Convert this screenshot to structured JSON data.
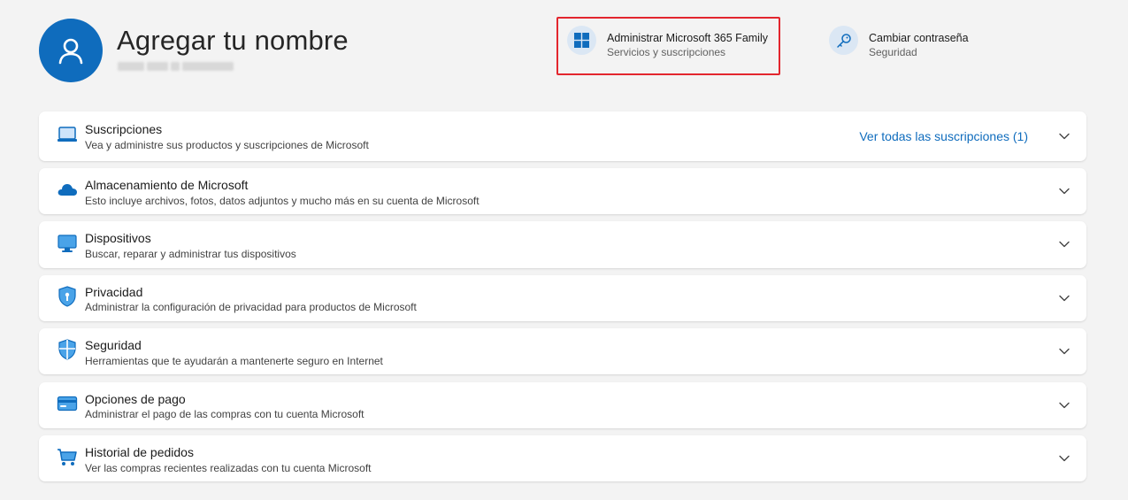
{
  "profile": {
    "name": "Agregar tu nombre"
  },
  "quick_actions": [
    {
      "title": "Administrar Microsoft 365 Family",
      "subtitle": "Servicios y suscripciones",
      "icon": "windows-logo-icon"
    },
    {
      "title": "Cambiar contraseña",
      "subtitle": "Seguridad",
      "icon": "key-icon"
    }
  ],
  "sections": [
    {
      "title": "Suscripciones",
      "subtitle": "Vea y administre sus productos y suscripciones de Microsoft",
      "icon": "laptop-icon",
      "link": "Ver todas las suscripciones (1)"
    },
    {
      "title": "Almacenamiento de Microsoft",
      "subtitle": "Esto incluye archivos, fotos, datos adjuntos y mucho más en su cuenta de Microsoft",
      "icon": "cloud-icon"
    },
    {
      "title": "Dispositivos",
      "subtitle": "Buscar, reparar y administrar tus dispositivos",
      "icon": "monitor-icon"
    },
    {
      "title": "Privacidad",
      "subtitle": "Administrar la configuración de privacidad para productos de Microsoft",
      "icon": "privacy-shield-icon"
    },
    {
      "title": "Seguridad",
      "subtitle": "Herramientas que te ayudarán a mantenerte seguro en Internet",
      "icon": "security-shield-icon"
    },
    {
      "title": "Opciones de pago",
      "subtitle": "Administrar el pago de las compras con tu cuenta Microsoft",
      "icon": "credit-card-icon"
    },
    {
      "title": "Historial de pedidos",
      "subtitle": "Ver las compras recientes realizadas con tu cuenta Microsoft",
      "icon": "shopping-cart-icon"
    }
  ],
  "colors": {
    "accent": "#0f6cbd",
    "highlight_box": "#e3262e",
    "background": "#f3f3f3"
  }
}
